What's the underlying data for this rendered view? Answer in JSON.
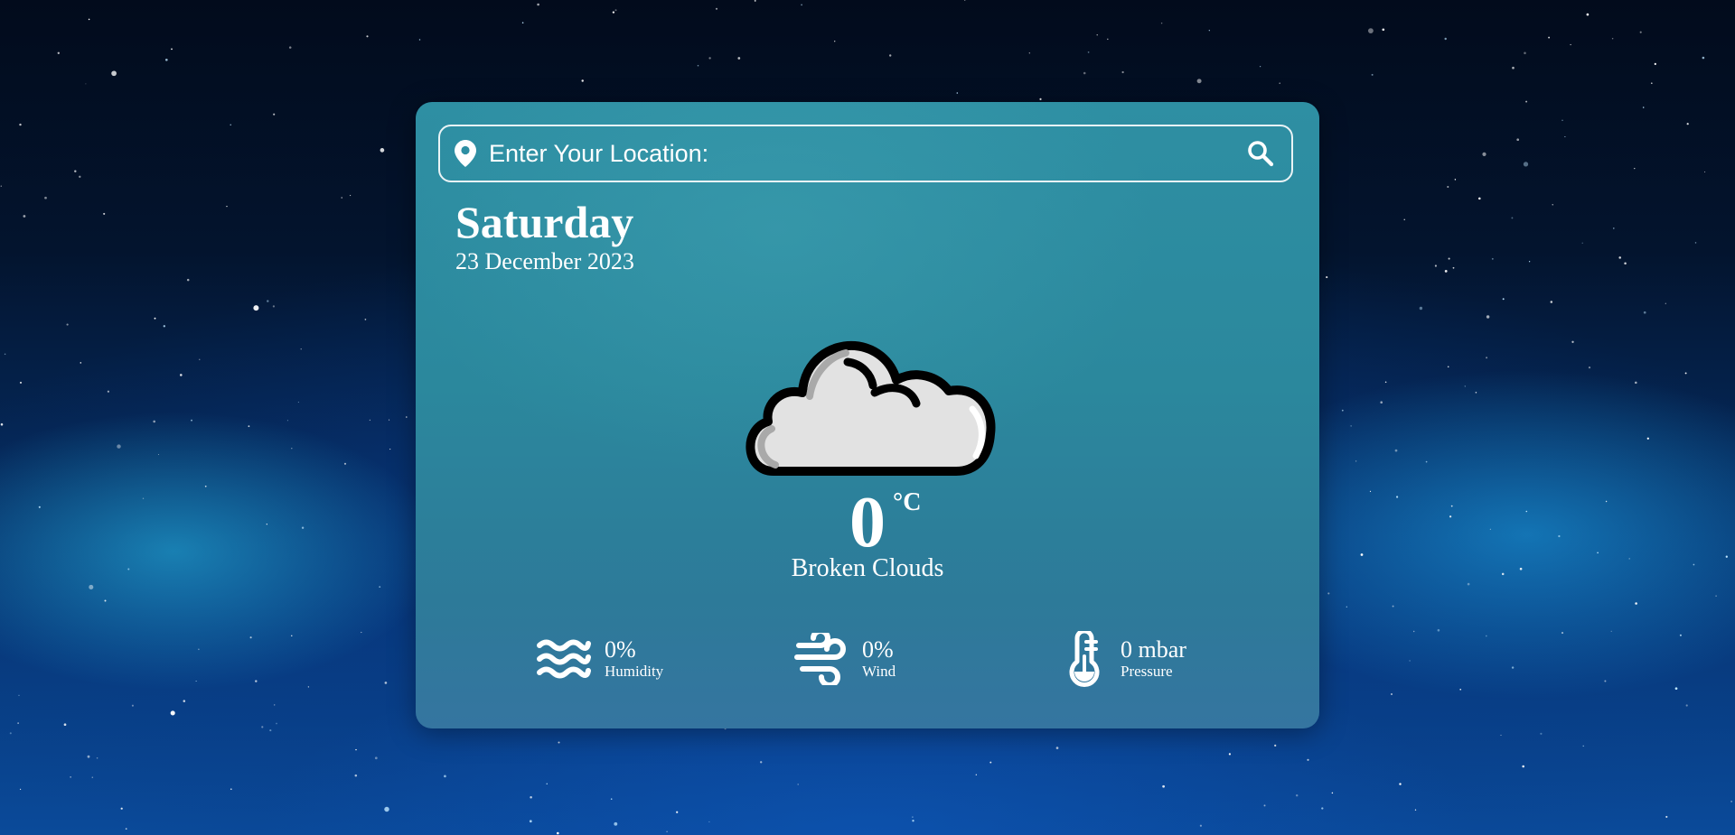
{
  "search": {
    "placeholder": "Enter Your Location:",
    "value": ""
  },
  "weather": {
    "day": "Saturday",
    "date": "23 December 2023",
    "temperature": "0",
    "unit": "°C",
    "condition": "Broken Clouds",
    "icon": "broken-clouds-icon"
  },
  "stats": {
    "humidity": {
      "value": "0%",
      "label": "Humidity",
      "icon": "water-waves-icon"
    },
    "wind": {
      "value": "0%",
      "label": "Wind",
      "icon": "wind-icon"
    },
    "pressure": {
      "value": "0 mbar",
      "label": "Pressure",
      "icon": "thermometer-icon"
    }
  },
  "colors": {
    "card": "#2e8fa3",
    "text": "#ffffff",
    "background": "#03142e"
  }
}
